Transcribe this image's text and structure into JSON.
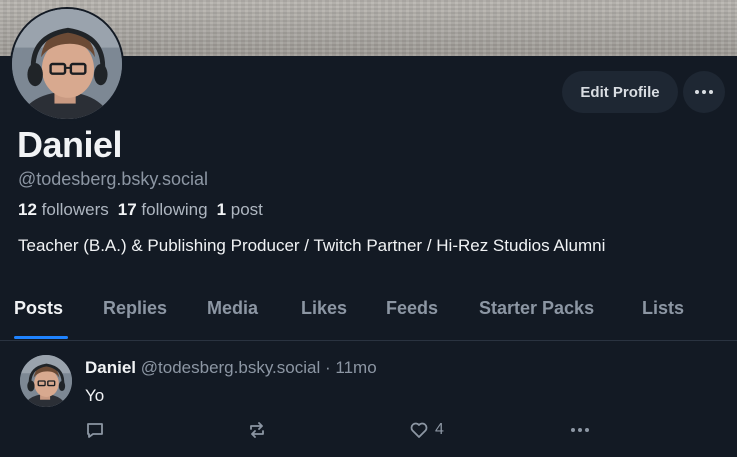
{
  "profile": {
    "display_name": "Daniel",
    "handle": "@todesberg.bsky.social",
    "followers_count": "12",
    "followers_label": "followers",
    "following_count": "17",
    "following_label": "following",
    "posts_count": "1",
    "posts_label": "post",
    "bio": "Teacher (B.A.) & Publishing Producer / Twitch Partner / Hi-Rez Studios Alumni"
  },
  "actions": {
    "edit_profile_label": "Edit Profile",
    "more_icon": "ellipsis-icon"
  },
  "tabs": [
    {
      "label": "Posts",
      "active": true
    },
    {
      "label": "Replies"
    },
    {
      "label": "Media"
    },
    {
      "label": "Likes"
    },
    {
      "label": "Feeds"
    },
    {
      "label": "Starter Packs"
    },
    {
      "label": "Lists"
    }
  ],
  "posts": [
    {
      "author": "Daniel",
      "handle": "@todesberg.bsky.social",
      "separator": "·",
      "time": "11mo",
      "text": "Yo",
      "like_count": "4"
    }
  ],
  "colors": {
    "background": "#131a24",
    "accent": "#1f83ff",
    "muted_text": "#8c96a3",
    "button_bg": "#1e2733"
  }
}
